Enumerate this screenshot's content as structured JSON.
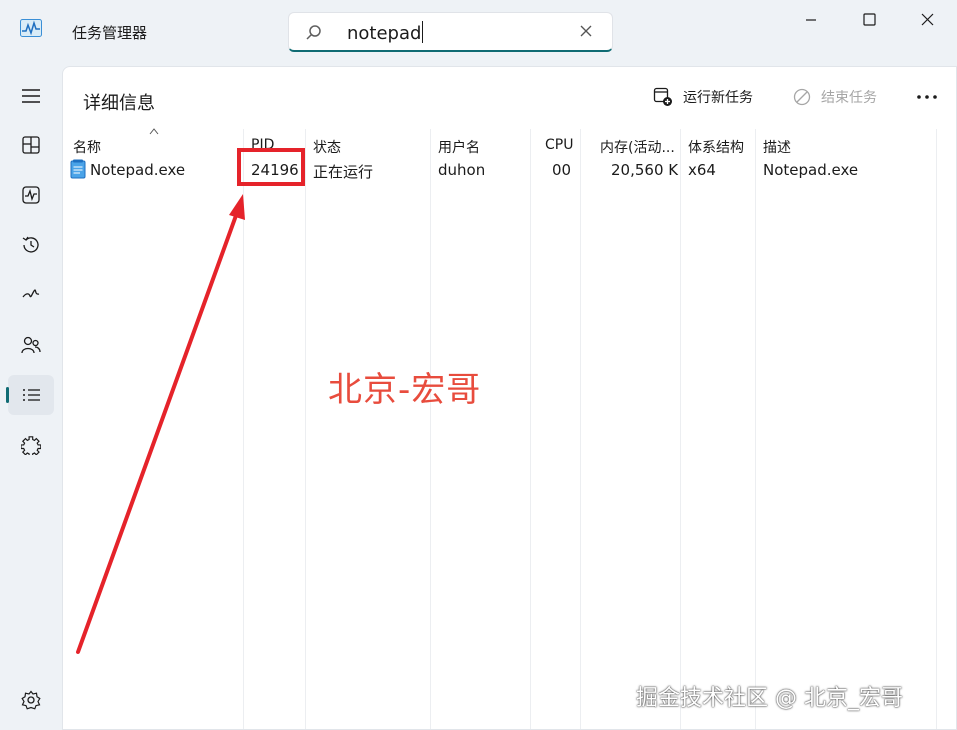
{
  "window": {
    "title": "任务管理器",
    "search_value": "notepad"
  },
  "page": {
    "title": "详细信息",
    "run_new_task": "运行新任务",
    "end_task": "结束任务"
  },
  "table": {
    "headers": [
      "名称",
      "PID",
      "状态",
      "用户名",
      "CPU",
      "内存(活动...",
      "体系结构",
      "描述"
    ],
    "rows": [
      [
        "Notepad.exe",
        "24196",
        "正在运行",
        "duhon",
        "00",
        "20,560 K",
        "x64",
        "Notepad.exe"
      ]
    ]
  },
  "annotations": {
    "watermark": "北京-宏哥",
    "credit": "掘金技术社区 @ 北京_宏哥"
  },
  "colors": {
    "accent": "#0f6b73",
    "annotation_red": "#e5232a",
    "panel_bg": "#ffffff",
    "window_bg": "#eef2f6"
  },
  "icons": {
    "sidebar": [
      "menu-icon",
      "processes-icon",
      "performance-icon",
      "app-history-icon",
      "startup-apps-icon",
      "users-icon",
      "details-icon",
      "services-icon",
      "settings-icon"
    ],
    "toolbar": [
      "run-new-task-icon",
      "end-task-icon",
      "more-icon"
    ]
  }
}
